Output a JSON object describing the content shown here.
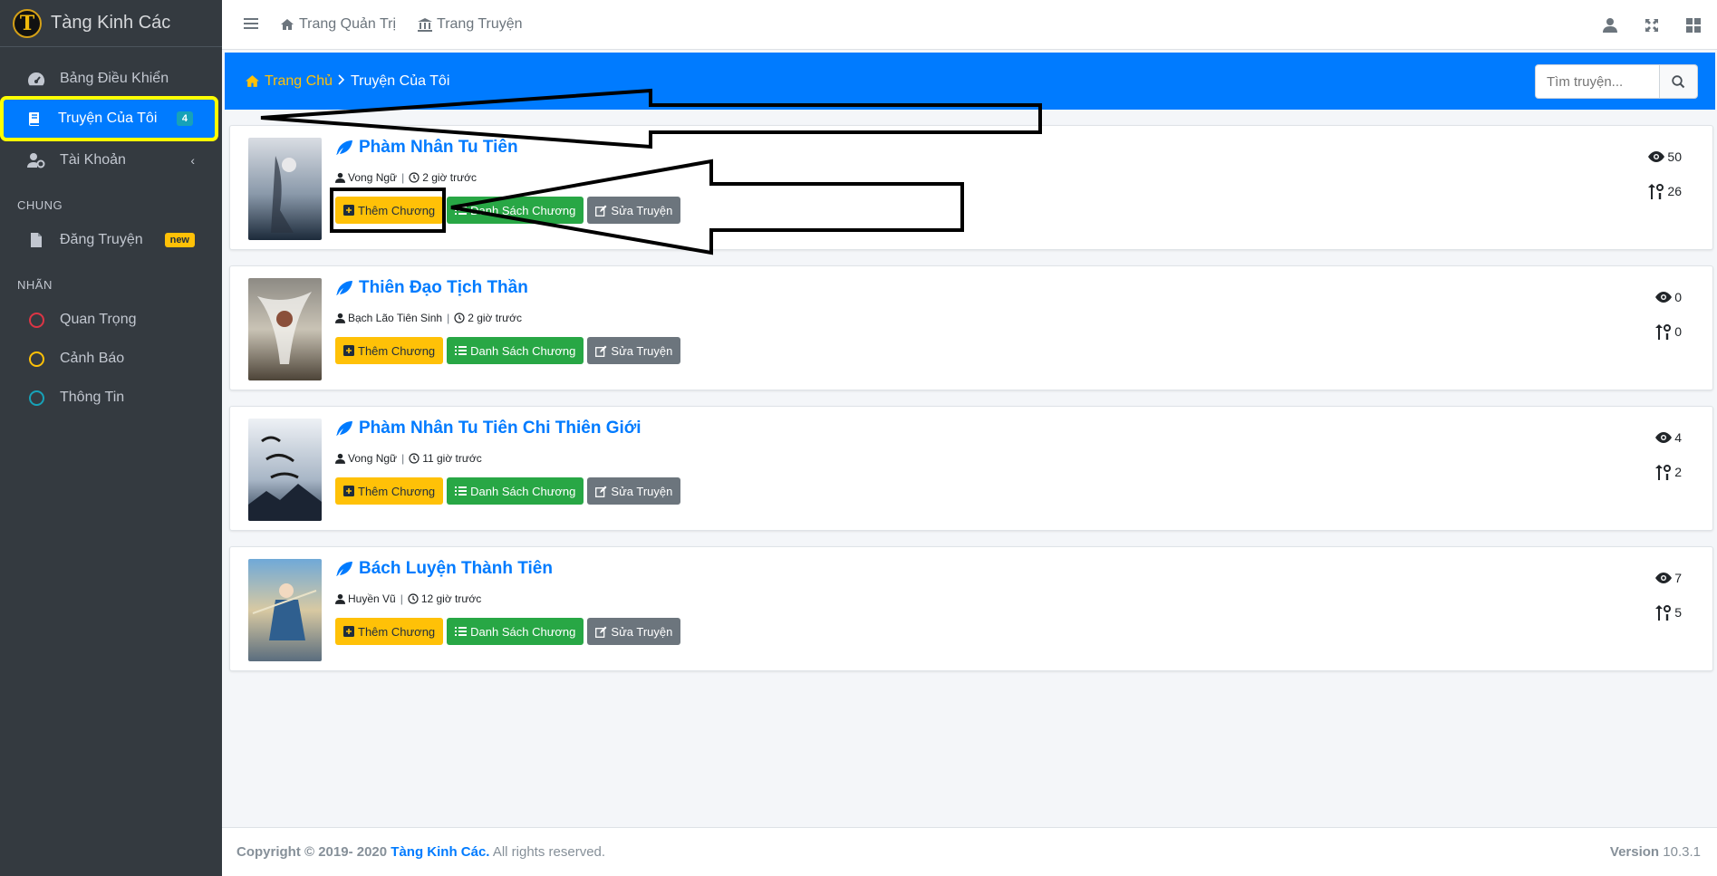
{
  "brand": {
    "logo_letter": "T",
    "name": "Tàng Kinh Các"
  },
  "sidebar": {
    "items": [
      {
        "label": "Bảng Điều Khiển",
        "icon": "dashboard-icon"
      },
      {
        "label": "Truyện Của Tôi",
        "icon": "book-icon",
        "badge": "4",
        "active": true
      },
      {
        "label": "Tài Khoản",
        "icon": "user-cog-icon",
        "chevron": "‹"
      }
    ],
    "section_general": "CHUNG",
    "general_items": [
      {
        "label": "Đăng Truyện",
        "icon": "file-icon",
        "badge": "new"
      }
    ],
    "section_labels": "NHÃN",
    "labels": [
      {
        "label": "Quan Trọng",
        "color": "#dc3545"
      },
      {
        "label": "Cảnh Báo",
        "color": "#ffc107"
      },
      {
        "label": "Thông Tin",
        "color": "#17a2b8"
      }
    ]
  },
  "topbar": {
    "links": [
      {
        "label": "Trang Quản Trị",
        "icon": "home-icon"
      },
      {
        "label": "Trang Truyện",
        "icon": "bank-icon"
      }
    ],
    "right_icons": [
      "user-icon",
      "fullscreen-icon",
      "grid-icon"
    ]
  },
  "header": {
    "breadcrumb_home": "Trang Chủ",
    "breadcrumb_current": "Truyện Của Tôi",
    "search_placeholder": "Tìm truyện..."
  },
  "buttons": {
    "add_chapter": "Thêm Chương",
    "chapter_list": "Danh Sách Chương",
    "edit_story": "Sửa Truyện"
  },
  "stories": [
    {
      "title": "Phàm Nhân Tu Tiên",
      "author": "Vong Ngữ",
      "time": "2 giờ trước",
      "views": "50",
      "ranking": "26"
    },
    {
      "title": "Thiên Đạo Tịch Thần",
      "author": "Bạch Lão Tiên Sinh",
      "time": "2 giờ trước",
      "views": "0",
      "ranking": "0"
    },
    {
      "title": "Phàm Nhân Tu Tiên Chi Thiên Giới",
      "author": "Vong Ngữ",
      "time": "11 giờ trước",
      "views": "4",
      "ranking": "2"
    },
    {
      "title": "Bách Luyện Thành Tiên",
      "author": "Huyền Vũ",
      "time": "12 giờ trước",
      "views": "7",
      "ranking": "5"
    }
  ],
  "footer": {
    "copyright": "Copyright © 2019- 2020",
    "brand": "Tàng Kinh Các.",
    "rights": "All rights reserved.",
    "version_label": "Version",
    "version": "10.3.1"
  }
}
